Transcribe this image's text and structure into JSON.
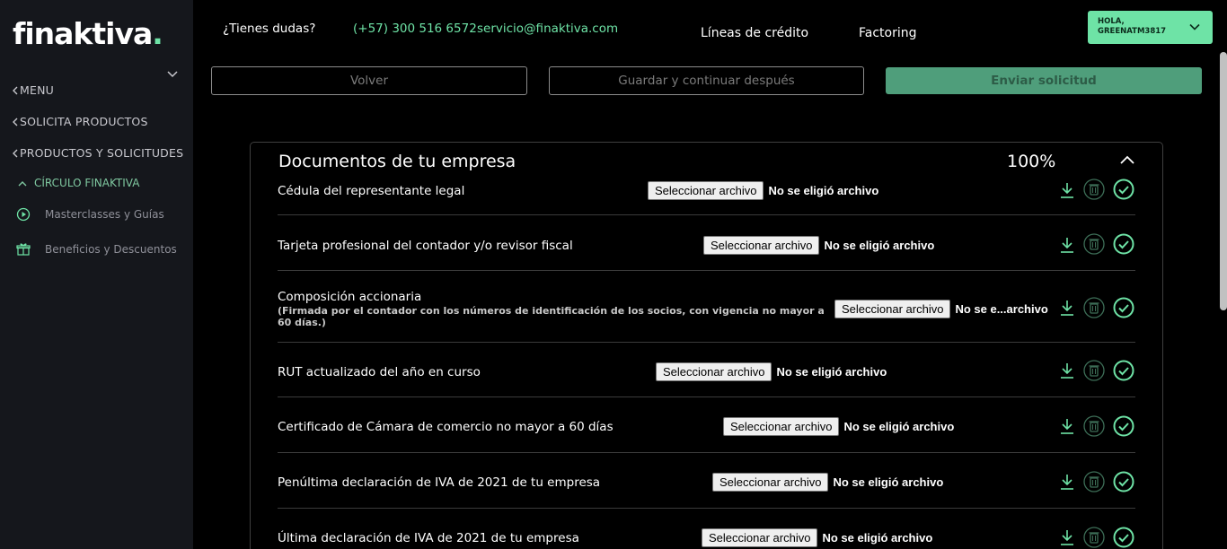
{
  "brand": {
    "name": "finaktiva",
    "dot": "."
  },
  "colors": {
    "accent": "#6ee3a6",
    "sidebar_bg": "#15171c",
    "page_bg": "#000000",
    "primary_button": "#4f9e7b"
  },
  "sidebar": {
    "menu": "MENU",
    "items": [
      {
        "label": "SOLICITA PRODUCTOS"
      },
      {
        "label": "PRODUCTOS Y SOLICITUDES"
      }
    ],
    "circle": {
      "label": "CÍRCULO FINAKTIVA",
      "links": [
        {
          "label": "Masterclasses y Guías",
          "icon": "play-circle-icon"
        },
        {
          "label": "Beneficios y Descuentos",
          "icon": "gift-icon"
        }
      ]
    }
  },
  "header": {
    "question": "¿Tienes dudas?",
    "phone": "(+57) 300 516 6572",
    "email": "servicio@finaktiva.com",
    "nav": [
      "Líneas de crédito",
      "Factoring"
    ],
    "user": {
      "greeting": "HOLA,",
      "name": "GREENATM3817"
    }
  },
  "actions": {
    "back": "Volver",
    "save_later": "Guardar y continuar después",
    "submit": "Enviar solicitud"
  },
  "documents": {
    "title": "Documentos de tu empresa",
    "progress": "100%",
    "file_button": "Seleccionar archivo",
    "rows": [
      {
        "label": "Cédula del representante legal",
        "status": "No se eligió archivo"
      },
      {
        "label": "Tarjeta profesional del contador y/o revisor fiscal",
        "status": "No se eligió archivo"
      },
      {
        "label": "Composición accionaria",
        "note": "(Firmada por el contador con los números de identificación de los socios, con vigencia no mayor a 60 días.)",
        "status": "No se e...archivo"
      },
      {
        "label": "RUT actualizado del año en curso",
        "status": "No se eligió archivo"
      },
      {
        "label": "Certificado de Cámara de comercio no mayor a 60 días",
        "status": "No se eligió archivo"
      },
      {
        "label": "Penúltima declaración de IVA de 2021 de tu empresa",
        "status": "No se eligió archivo"
      },
      {
        "label": "Última declaración de IVA de 2021 de tu empresa",
        "status": "No se eligió archivo"
      }
    ]
  }
}
